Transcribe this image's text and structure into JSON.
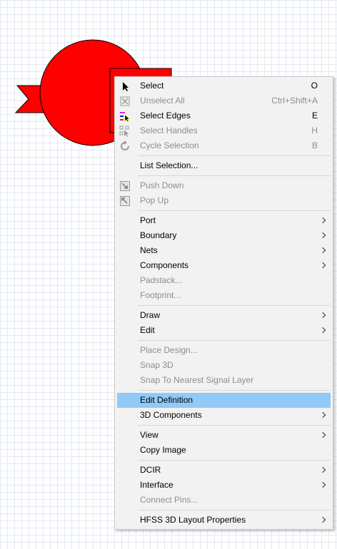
{
  "colors": {
    "shape_fill": "#ff0000",
    "menu_bg": "#f2f2f2",
    "highlight": "#91c9f7",
    "disabled_text": "#8d8d8d"
  },
  "menu": {
    "select": {
      "label": "Select",
      "shortcut": "O"
    },
    "unselect_all": {
      "label": "Unselect All",
      "shortcut": "Ctrl+Shift+A"
    },
    "select_edges": {
      "label": "Select Edges",
      "shortcut": "E"
    },
    "select_handles": {
      "label": "Select Handles",
      "shortcut": "H"
    },
    "cycle_selection": {
      "label": "Cycle Selection",
      "shortcut": "B"
    },
    "list_selection": {
      "label": "List Selection..."
    },
    "push_down": {
      "label": "Push Down"
    },
    "pop_up": {
      "label": "Pop Up"
    },
    "port": {
      "label": "Port"
    },
    "boundary": {
      "label": "Boundary"
    },
    "nets": {
      "label": "Nets"
    },
    "components": {
      "label": "Components"
    },
    "padstack": {
      "label": "Padstack..."
    },
    "footprint": {
      "label": "Footprint..."
    },
    "draw": {
      "label": "Draw"
    },
    "edit": {
      "label": "Edit"
    },
    "place_design": {
      "label": "Place Design..."
    },
    "snap_3d": {
      "label": "Snap 3D"
    },
    "snap_nearest": {
      "label": "Snap To Nearest Signal Layer"
    },
    "edit_definition": {
      "label": "Edit Definition"
    },
    "components_3d": {
      "label": "3D Components"
    },
    "view": {
      "label": "View"
    },
    "copy_image": {
      "label": "Copy Image"
    },
    "dcir": {
      "label": "DCIR"
    },
    "interface": {
      "label": "Interface"
    },
    "connect_pins": {
      "label": "Connect Pins..."
    },
    "hfss_props": {
      "label": "HFSS 3D Layout Properties"
    }
  }
}
